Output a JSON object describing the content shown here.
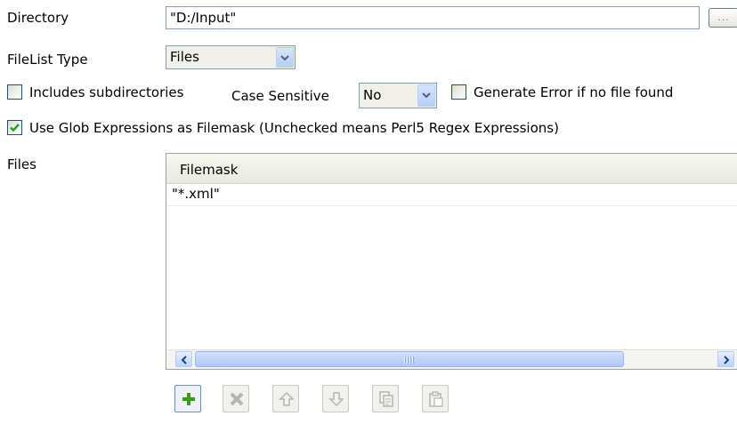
{
  "directory": {
    "label": "Directory",
    "value": "\"D:/Input\"",
    "browse_label": "..."
  },
  "filelist_type": {
    "label": "FileList Type",
    "value": "Files"
  },
  "includes_subdirectories": {
    "label": "Includes subdirectories",
    "checked": false
  },
  "case_sensitive": {
    "label": "Case Sensitive",
    "value": "No"
  },
  "generate_error": {
    "label": "Generate Error if no file found",
    "checked": false
  },
  "use_glob": {
    "label": "Use Glob Expressions as Filemask (Unchecked means Perl5 Regex Expressions)",
    "checked": true
  },
  "files": {
    "label": "Files",
    "column_header": "Filemask",
    "rows": [
      {
        "filemask": "\"*.xml\""
      }
    ]
  },
  "toolbar": {
    "buttons": [
      {
        "name": "add",
        "icon": "plus-icon",
        "enabled": true
      },
      {
        "name": "remove",
        "icon": "x-icon",
        "enabled": false
      },
      {
        "name": "move-up",
        "icon": "arrow-up-icon",
        "enabled": false
      },
      {
        "name": "move-down",
        "icon": "arrow-down-icon",
        "enabled": false
      },
      {
        "name": "copy",
        "icon": "copy-icon",
        "enabled": false
      },
      {
        "name": "paste",
        "icon": "paste-icon",
        "enabled": false
      }
    ]
  },
  "colors": {
    "check": "#21a121",
    "add_plus": "#3a9b1a",
    "disabled_icon": "#b4b4b4"
  }
}
